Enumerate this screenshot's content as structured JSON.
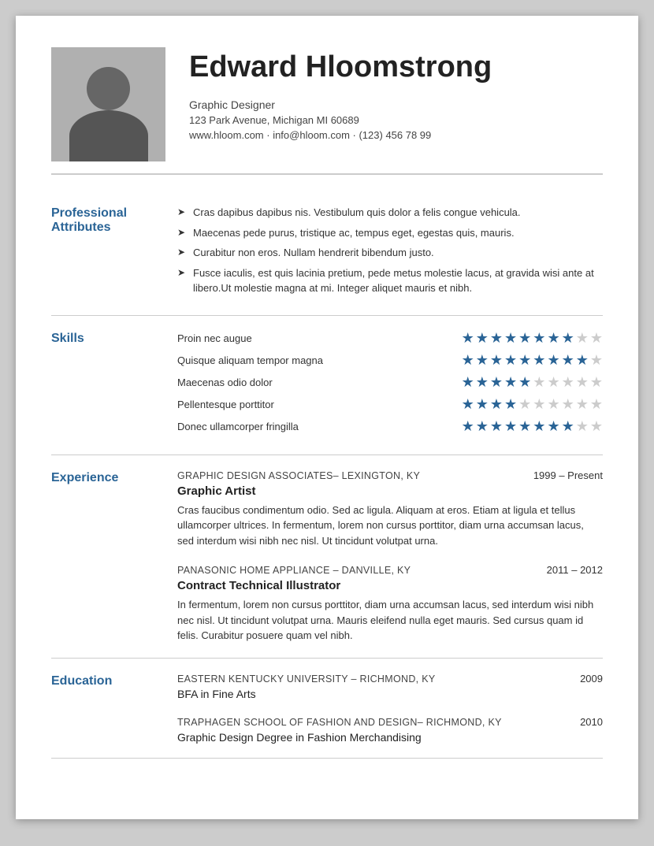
{
  "header": {
    "name": "Edward Hloomstrong",
    "title": "Graphic Designer",
    "address": "123 Park Avenue, Michigan MI 60689",
    "contact": "www.hloom.com · info@hloom.com · (123) 456 78 99"
  },
  "sections": {
    "professional": {
      "label": "Professional Attributes",
      "items": [
        "Cras dapibus dapibus nis. Vestibulum quis dolor a felis congue vehicula.",
        "Maecenas pede purus, tristique ac, tempus eget, egestas quis, mauris.",
        "Curabitur non eros. Nullam hendrerit bibendum justo.",
        "Fusce iaculis, est quis lacinia pretium, pede metus molestie lacus, at gravida wisi ante at libero.Ut molestie magna at mi. Integer aliquet mauris et nibh."
      ]
    },
    "skills": {
      "label": "Skills",
      "items": [
        {
          "name": "Proin nec augue",
          "filled": 8,
          "empty": 2
        },
        {
          "name": "Quisque aliquam tempor magna",
          "filled": 9,
          "empty": 1
        },
        {
          "name": "Maecenas odio dolor",
          "filled": 5,
          "empty": 5
        },
        {
          "name": "Pellentesque porttitor",
          "filled": 4,
          "empty": 6
        },
        {
          "name": "Donec ullamcorper fringilla",
          "filled": 8,
          "empty": 2
        }
      ]
    },
    "experience": {
      "label": "Experience",
      "items": [
        {
          "company": "Graphic Design Associates– Lexington, KY",
          "dates": "1999 – Present",
          "title": "Graphic Artist",
          "desc": "Cras faucibus condimentum odio. Sed ac ligula. Aliquam at eros. Etiam at ligula et tellus ullamcorper ultrices. In fermentum, lorem non cursus porttitor, diam urna accumsan lacus, sed interdum wisi nibh nec nisl. Ut tincidunt volutpat urna."
        },
        {
          "company": "Panasonic Home Appliance – Danville, KY",
          "dates": "2011 – 2012",
          "title": "Contract Technical Illustrator",
          "desc": "In fermentum, lorem non cursus porttitor, diam urna accumsan lacus, sed interdum wisi nibh nec nisl. Ut tincidunt volutpat urna. Mauris eleifend nulla eget mauris. Sed cursus quam id felis. Curabitur posuere quam vel nibh."
        }
      ]
    },
    "education": {
      "label": "Education",
      "items": [
        {
          "school": "Eastern Kentucky University – Richmond, KY",
          "year": "2009",
          "degree": "BFA in Fine Arts"
        },
        {
          "school": "Traphagen School of Fashion and Design– Richmond, KY",
          "year": "2010",
          "degree": "Graphic Design Degree in Fashion Merchandising"
        }
      ]
    }
  }
}
